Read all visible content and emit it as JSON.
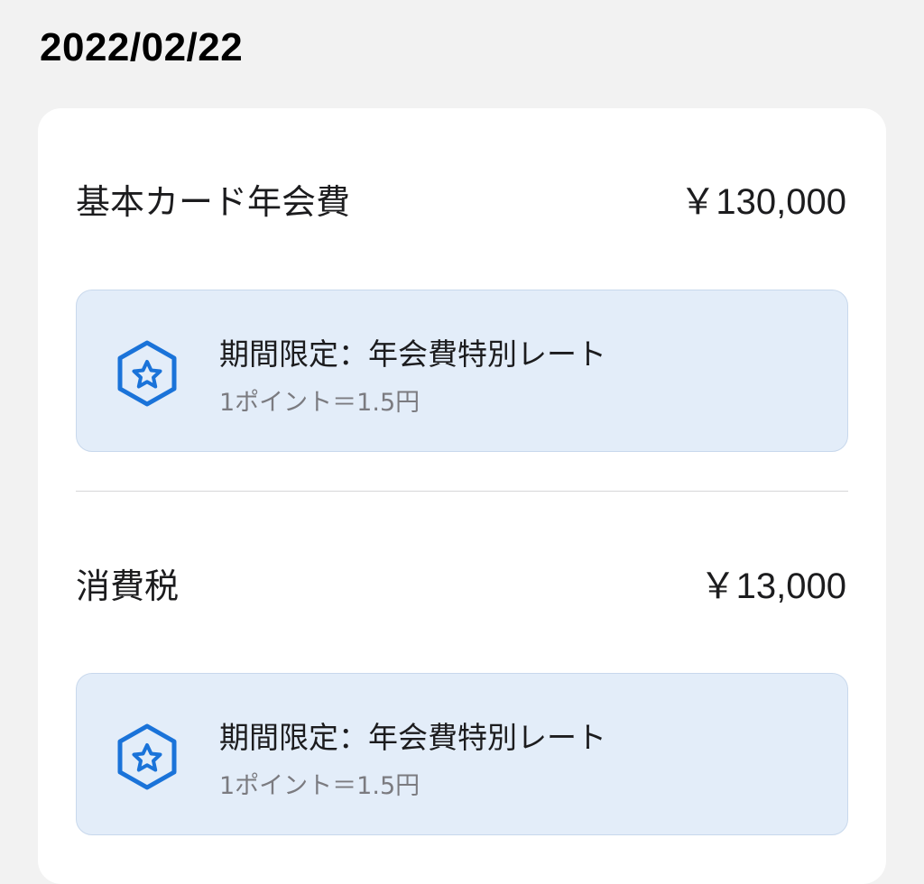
{
  "date": "2022/02/22",
  "items": [
    {
      "label": "基本カード年会費",
      "amount": "￥130,000",
      "promo": {
        "icon": "hexagon-star-icon",
        "title": "期間限定：年会費特別レート",
        "subtitle": "1ポイント＝1.5円"
      }
    },
    {
      "label": "消費税",
      "amount": "￥13,000",
      "promo": {
        "icon": "hexagon-star-icon",
        "title": "期間限定：年会費特別レート",
        "subtitle": "1ポイント＝1.5円"
      }
    }
  ],
  "colors": {
    "accent": "#1a73d9",
    "promo_background": "#e3edf9",
    "page_background": "#f2f2f2"
  }
}
